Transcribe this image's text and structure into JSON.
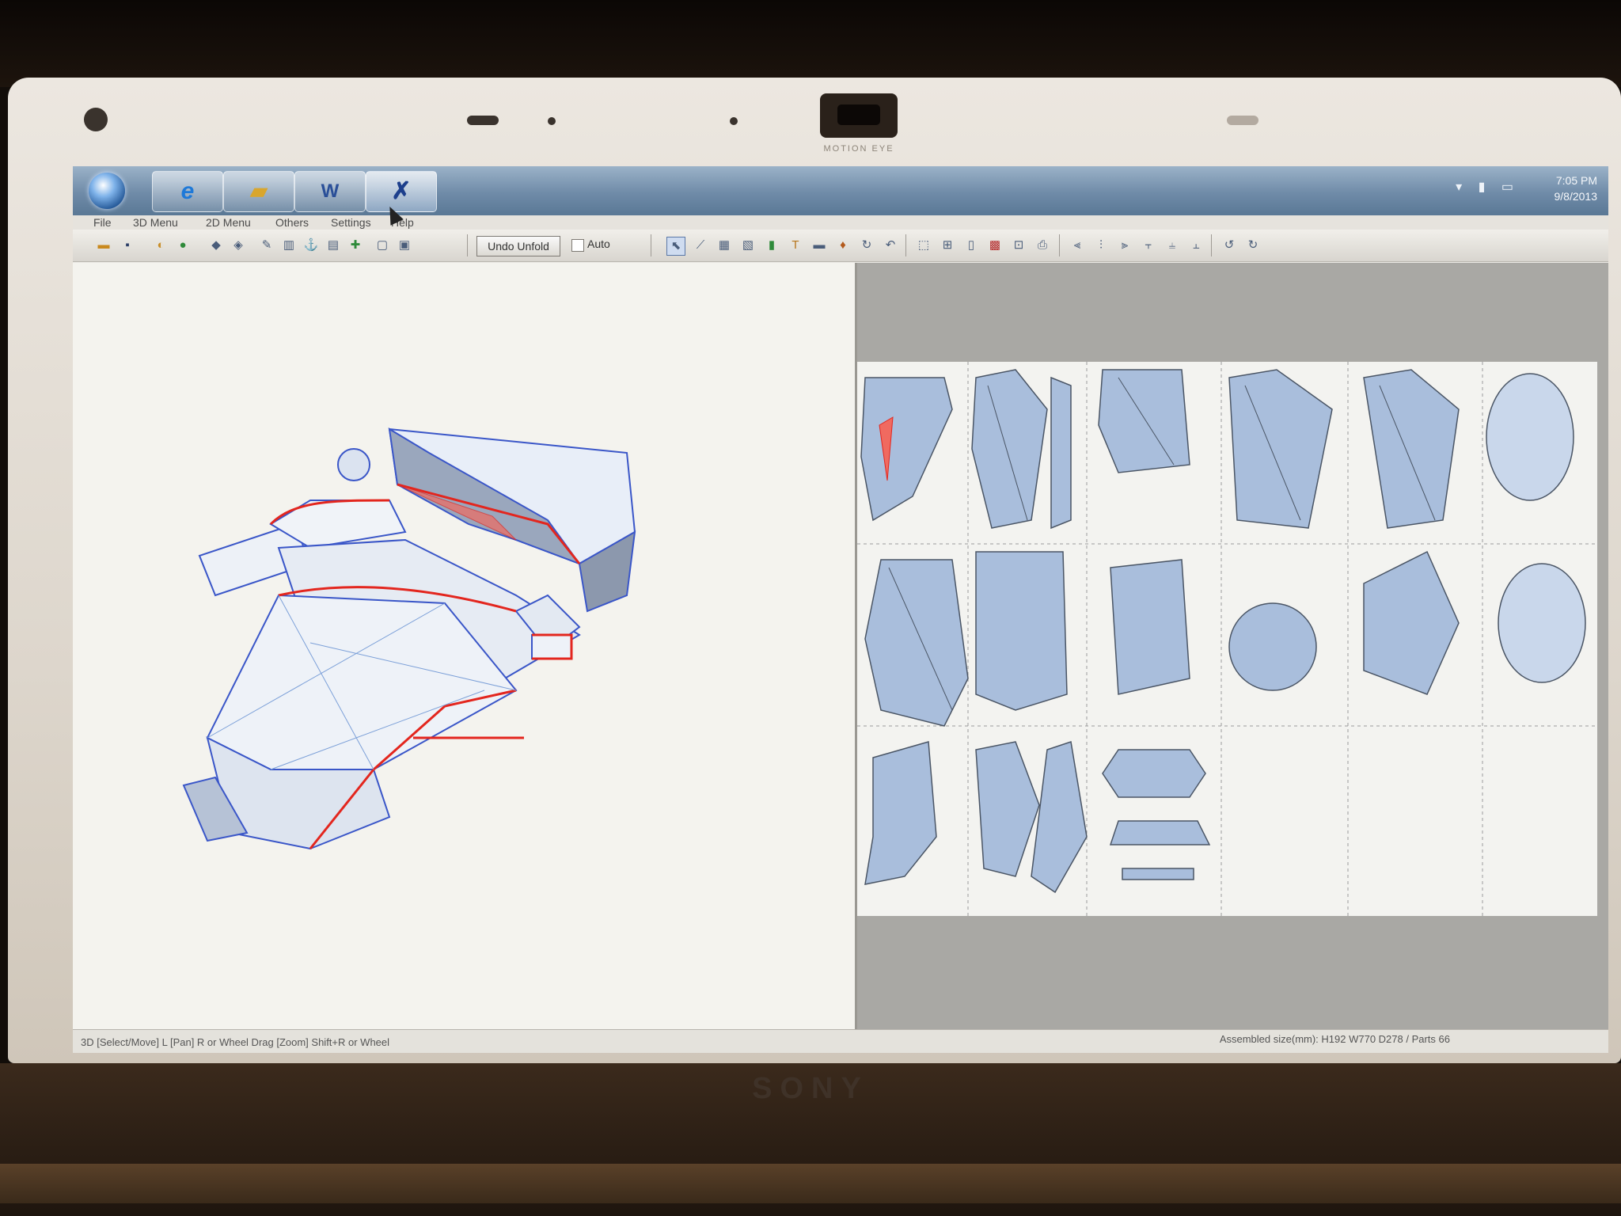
{
  "laptop": {
    "camera_label": "MOTION EYE",
    "brand": "SONY"
  },
  "taskbar": {
    "buttons": [
      {
        "icon": "windows-start-icon"
      },
      {
        "icon": "internet-explorer-icon"
      },
      {
        "icon": "folder-icon"
      },
      {
        "icon": "word-icon"
      },
      {
        "icon": "pepakura-icon"
      }
    ],
    "time": "7:05 PM",
    "date": "9/8/2013"
  },
  "menubar": {
    "items": [
      "File",
      "3D Menu",
      "2D Menu",
      "Others",
      "Settings",
      "Help"
    ]
  },
  "toolbar": {
    "undo_unfold_label": "Undo Unfold",
    "auto_label": "Auto",
    "auto_checked": false
  },
  "status": {
    "left": "3D [Select/Move] L [Pan] R or Wheel Drag [Zoom] Shift+R or Wheel",
    "right": "Assembled size(mm): H192 W770 D278 / Parts 66"
  },
  "colors": {
    "model_fill": "#a9bedc",
    "model_line": "#3a56c8",
    "edge_highlight": "#e3261e",
    "taskbar": "#6f8ba8"
  }
}
